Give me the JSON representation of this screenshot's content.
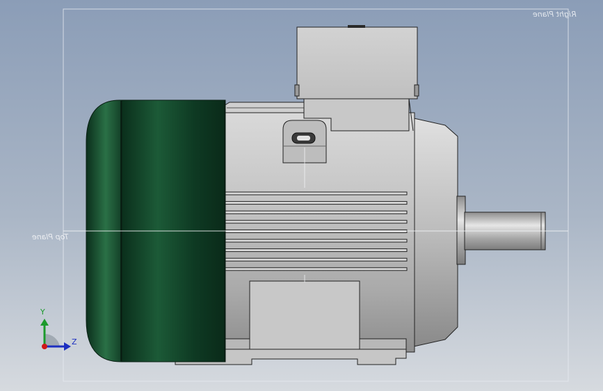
{
  "viewport": {
    "background_top": "#8b9db7",
    "background_bottom": "#d6dadf"
  },
  "planes": {
    "right_plane_label": "Right Plane",
    "top_plane_label": "Top Plane"
  },
  "triad": {
    "y_label": "Y",
    "z_label": "Z",
    "y_color": "#1c9a2c",
    "z_color": "#1d2fc0",
    "x_color": "#d01818"
  },
  "model": {
    "fan_cover_color": "#0f3d24",
    "body_color": "#c9c9c9",
    "shaft_color": "#b4b4b4",
    "cooling_fin_count": 9
  }
}
